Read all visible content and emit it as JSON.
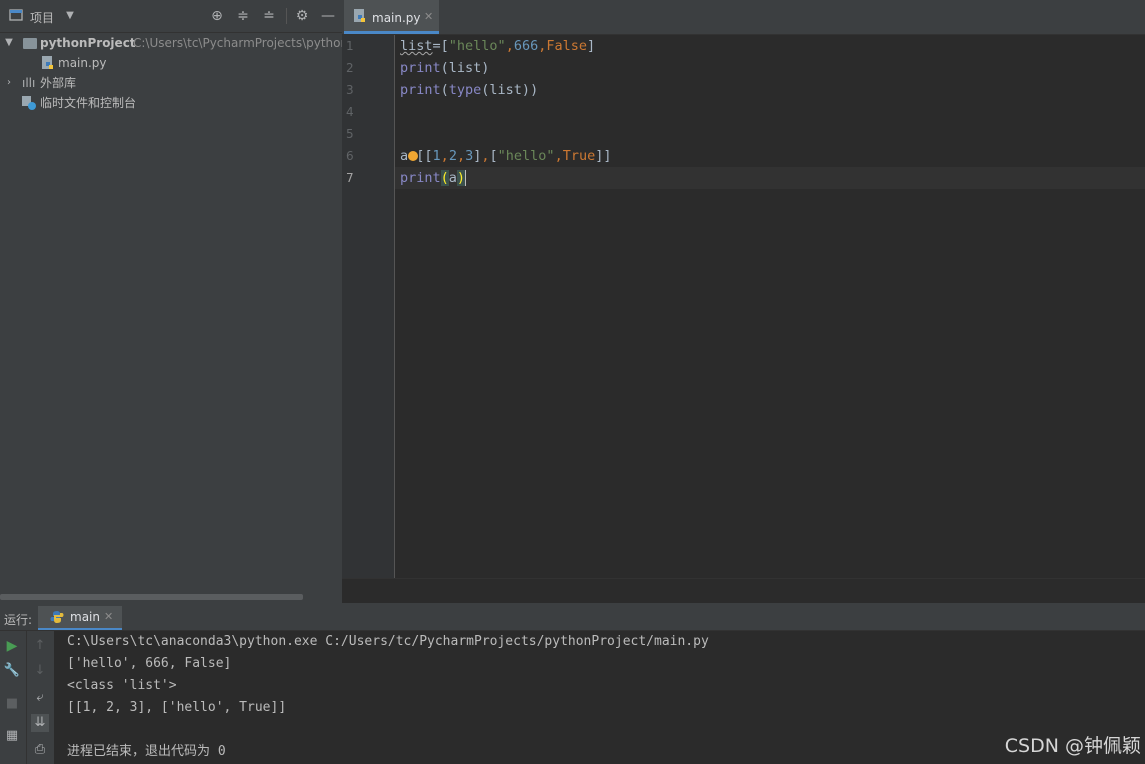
{
  "project_panel": {
    "title": "项目",
    "tree": [
      {
        "name": "pythonProject",
        "path": "C:\\Users\\tc\\PycharmProjects\\python"
      },
      {
        "name": "main.py"
      },
      {
        "name": "外部库"
      },
      {
        "name": "临时文件和控制台"
      }
    ]
  },
  "editor": {
    "tab": {
      "label": "main.py"
    },
    "line_numbers": [
      "1",
      "2",
      "3",
      "4",
      "5",
      "6",
      "7"
    ]
  },
  "run_panel": {
    "label": "运行:",
    "tab_label": "main",
    "console_lines": [
      "C:\\Users\\tc\\anaconda3\\python.exe C:/Users/tc/PycharmProjects/pythonProject/main.py",
      "['hello', 666, False]",
      "<class 'list'>",
      "[[1, 2, 3], ['hello', True]]",
      "",
      "进程已结束，退出代码为 0"
    ]
  },
  "code_tokens": {
    "l1": [
      "list",
      "=[",
      "\"hello\"",
      ",",
      "666",
      ",",
      "False",
      "]"
    ],
    "l2": [
      "print",
      "(list)"
    ],
    "l3": [
      "print",
      "(",
      "type",
      "(list))"
    ],
    "l6": [
      "a",
      "=[[",
      "1",
      ",",
      "2",
      ",",
      "3",
      "]",
      ",",
      "[",
      "\"hello\"",
      ",",
      "True",
      "]]"
    ],
    "l7": [
      "print",
      "(",
      "a",
      ")"
    ]
  },
  "watermark": "CSDN @钟佩颖",
  "colors": {
    "accent": "#4a88c7",
    "string": "#6a8759",
    "number": "#6897bb",
    "keyword": "#cc7832",
    "builtin": "#8888c6",
    "run_green": "#499c54"
  }
}
